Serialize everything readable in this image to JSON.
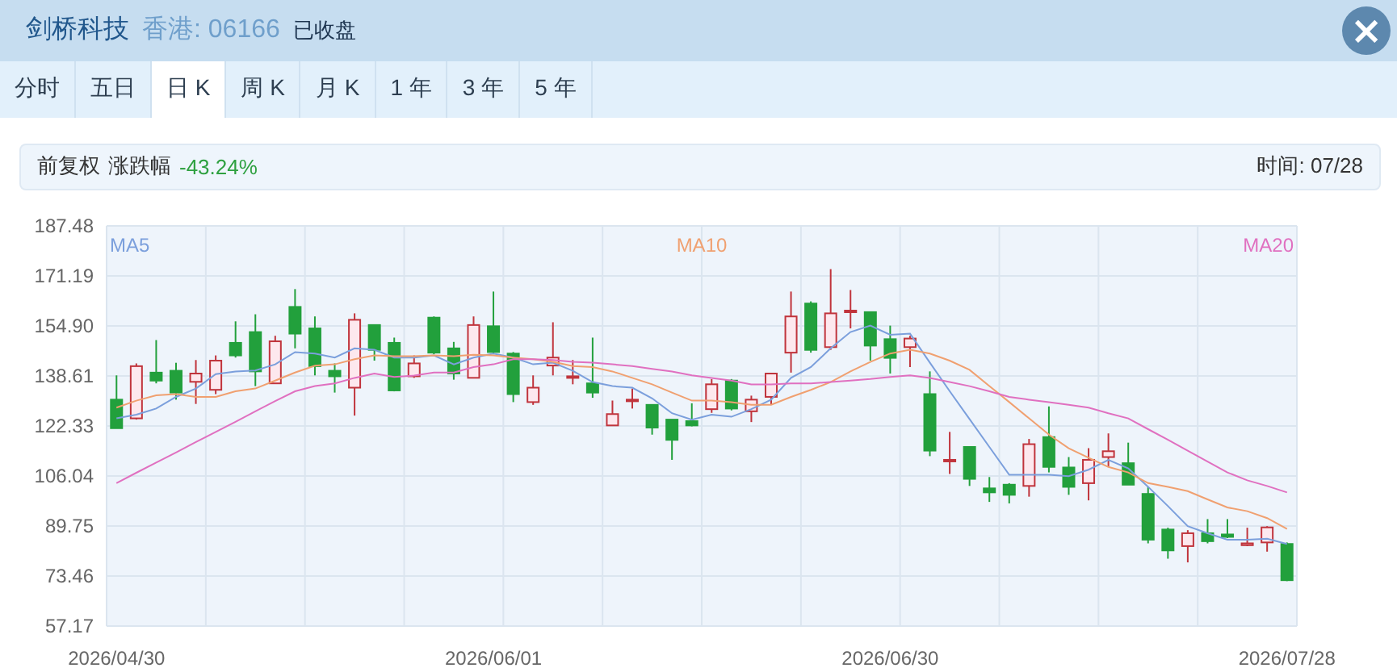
{
  "header": {
    "title": "剑桥科技",
    "market": "香港: 06166",
    "status": "已收盘",
    "close": "×"
  },
  "tabs": [
    {
      "label": "分时",
      "selected": false
    },
    {
      "label": "五日",
      "selected": false
    },
    {
      "label": "日 K",
      "selected": true
    },
    {
      "label": "周 K",
      "selected": false
    },
    {
      "label": "月 K",
      "selected": false
    },
    {
      "label": "1 年",
      "selected": false
    },
    {
      "label": "3 年",
      "selected": false
    },
    {
      "label": "5 年",
      "selected": false
    }
  ],
  "info": {
    "adjust": "前复权",
    "change_label": "涨跌幅",
    "change": "-43.24%",
    "time": "时间: 07/28"
  },
  "chart": {
    "chart_data": {
      "type": "candlestick",
      "grid": true,
      "ylim": [
        57.17,
        187.48
      ],
      "categories": [
        "2026/04/30",
        null,
        null,
        null,
        null,
        null,
        null,
        null,
        null,
        null,
        null,
        null,
        null,
        null,
        null,
        null,
        null,
        null,
        null,
        "2026/06/01",
        null,
        null,
        null,
        null,
        null,
        null,
        null,
        null,
        null,
        null,
        null,
        null,
        null,
        null,
        null,
        null,
        null,
        null,
        null,
        "2026/06/30",
        null,
        null,
        null,
        null,
        null,
        null,
        null,
        null,
        null,
        null,
        null,
        null,
        null,
        null,
        null,
        null,
        null,
        null,
        null,
        "2026/07/28"
      ],
      "yticks": [
        {
          "value": 57.17,
          "label": "57.17"
        },
        {
          "value": 73.46,
          "label": "73.46"
        },
        {
          "value": 89.75,
          "label": "89.75"
        },
        {
          "value": 106.04,
          "label": "106.04"
        },
        {
          "value": 122.33,
          "label": "122.33"
        },
        {
          "value": 138.61,
          "label": "138.61"
        },
        {
          "value": 154.9,
          "label": "154.90"
        },
        {
          "value": 171.19,
          "label": "171.19"
        },
        {
          "value": 187.48,
          "label": "187.48"
        }
      ],
      "series": [
        {
          "name": "MA5",
          "type": "line",
          "color": "#7b9fdc",
          "values": [
            124.8,
            126.0,
            128.0,
            131.8,
            134.5,
            139.2,
            140.1,
            140.4,
            142.4,
            146.4,
            145.9,
            144.6,
            147.6,
            147.1,
            144.6,
            144.6,
            145.3,
            142.4,
            144.6,
            145.9,
            144.6,
            142.4,
            142.9,
            140.3,
            136.6,
            135.3,
            134.8,
            131.3,
            126.5,
            124.4,
            126.0,
            125.3,
            127.8,
            130.9,
            138.0,
            141.5,
            147.6,
            152.9,
            155.0,
            152.0,
            152.4,
            142.9,
            133.7,
            124.6,
            115.5,
            106.4,
            106.4,
            106.4,
            106.0,
            108.1,
            111.3,
            108.5,
            102.5,
            96.2,
            89.7,
            87.4,
            85.3,
            85.3,
            85.6,
            83.9
          ]
        },
        {
          "name": "MA10",
          "type": "line",
          "color": "#f0a070",
          "values": [
            128.3,
            130.6,
            132.3,
            132.7,
            131.8,
            131.8,
            133.6,
            134.5,
            137.1,
            139.7,
            142.0,
            142.4,
            144.1,
            145.3,
            145.0,
            145.0,
            145.3,
            145.0,
            145.5,
            145.3,
            144.6,
            144.1,
            143.2,
            141.8,
            141.5,
            140.1,
            138.0,
            135.9,
            133.2,
            130.6,
            130.6,
            130.1,
            129.2,
            129.2,
            131.8,
            134.1,
            136.6,
            140.1,
            143.2,
            145.9,
            147.1,
            145.9,
            143.6,
            140.6,
            135.3,
            130.1,
            124.8,
            119.5,
            115.1,
            112.0,
            109.0,
            107.2,
            103.7,
            102.5,
            101.1,
            98.4,
            95.8,
            94.6,
            92.3,
            88.8
          ]
        },
        {
          "name": "MA20",
          "type": "line",
          "color": "#e070c0",
          "values": [
            103.7,
            107.1,
            110.4,
            113.7,
            117.1,
            120.4,
            123.7,
            127.1,
            130.4,
            133.6,
            135.3,
            136.2,
            138.0,
            139.4,
            138.3,
            138.7,
            139.7,
            139.7,
            141.5,
            142.4,
            144.1,
            144.1,
            143.8,
            143.2,
            142.9,
            142.4,
            141.8,
            140.9,
            140.1,
            138.8,
            138.0,
            137.1,
            135.9,
            135.9,
            136.2,
            136.2,
            136.6,
            137.1,
            137.6,
            138.3,
            138.8,
            138.0,
            136.6,
            135.3,
            133.6,
            131.8,
            130.9,
            130.1,
            129.2,
            128.3,
            126.5,
            124.8,
            121.3,
            117.8,
            114.3,
            110.7,
            107.2,
            104.6,
            102.8,
            100.7
          ]
        }
      ],
      "ohlc": [
        [
          130.9,
          138.8,
          121.6,
          121.6
        ],
        [
          124.8,
          142.7,
          124.4,
          141.8
        ],
        [
          139.7,
          150.3,
          136.2,
          137.1
        ],
        [
          140.3,
          142.9,
          130.9,
          133.2
        ],
        [
          136.7,
          143.8,
          129.5,
          139.4
        ],
        [
          134.1,
          145.3,
          132.7,
          143.6
        ],
        [
          149.4,
          156.4,
          144.6,
          145.3
        ],
        [
          152.9,
          158.7,
          135.3,
          140.1
        ],
        [
          136.2,
          151.7,
          136.2,
          149.9
        ],
        [
          161.1,
          166.9,
          147.6,
          152.4
        ],
        [
          154.1,
          158.0,
          138.8,
          141.8
        ],
        [
          140.3,
          142.7,
          133.2,
          138.5
        ],
        [
          134.8,
          159.0,
          125.7,
          156.9
        ],
        [
          155.2,
          155.2,
          143.6,
          147.1
        ],
        [
          149.4,
          151.1,
          133.6,
          133.9
        ],
        [
          138.5,
          145.3,
          138.0,
          142.7
        ],
        [
          157.6,
          158.0,
          145.7,
          146.2
        ],
        [
          147.6,
          149.7,
          137.4,
          139.4
        ],
        [
          138.0,
          158.0,
          138.0,
          155.2
        ],
        [
          154.8,
          166.1,
          145.9,
          146.4
        ],
        [
          145.9,
          146.4,
          130.1,
          132.7
        ],
        [
          130.1,
          138.8,
          129.2,
          134.8
        ],
        [
          142.0,
          156.1,
          138.8,
          144.6
        ],
        [
          138.0,
          143.8,
          135.9,
          138.5
        ],
        [
          136.2,
          151.1,
          131.5,
          133.2
        ],
        [
          122.5,
          130.6,
          122.5,
          126.2
        ],
        [
          130.6,
          134.5,
          128.0,
          130.9
        ],
        [
          129.2,
          129.2,
          119.5,
          121.8
        ],
        [
          124.4,
          124.4,
          111.3,
          117.8
        ],
        [
          123.9,
          129.7,
          122.2,
          122.5
        ],
        [
          127.8,
          137.6,
          126.6,
          135.9
        ],
        [
          137.1,
          137.6,
          127.4,
          128.0
        ],
        [
          127.1,
          132.2,
          123.6,
          130.9
        ],
        [
          131.8,
          139.4,
          129.2,
          139.4
        ],
        [
          146.2,
          166.1,
          139.7,
          158.0
        ],
        [
          162.2,
          162.9,
          146.2,
          147.1
        ],
        [
          148.0,
          173.4,
          147.1,
          159.0
        ],
        [
          159.6,
          166.6,
          154.1,
          159.9
        ],
        [
          159.4,
          159.4,
          143.6,
          148.5
        ],
        [
          150.6,
          155.0,
          139.4,
          144.5
        ],
        [
          148.0,
          151.7,
          141.5,
          150.8
        ],
        [
          132.7,
          140.1,
          112.5,
          114.3
        ],
        [
          110.8,
          120.4,
          106.7,
          111.3
        ],
        [
          115.5,
          115.5,
          102.8,
          105.1
        ],
        [
          102.0,
          105.7,
          97.6,
          100.7
        ],
        [
          103.2,
          103.7,
          97.1,
          99.9
        ],
        [
          102.8,
          118.1,
          99.3,
          116.4
        ],
        [
          118.7,
          128.7,
          107.2,
          109.0
        ],
        [
          108.8,
          112.2,
          99.9,
          102.5
        ],
        [
          103.7,
          115.1,
          98.1,
          111.3
        ],
        [
          112.2,
          119.9,
          109.0,
          114.1
        ],
        [
          110.2,
          116.9,
          103.2,
          103.2
        ],
        [
          100.2,
          102.5,
          84.1,
          85.3
        ],
        [
          88.6,
          89.2,
          79.1,
          81.8
        ],
        [
          83.2,
          88.4,
          77.9,
          87.4
        ],
        [
          87.4,
          92.0,
          84.1,
          84.8
        ],
        [
          87.0,
          92.0,
          85.8,
          86.2
        ],
        [
          83.5,
          89.2,
          83.2,
          84.1
        ],
        [
          84.4,
          89.7,
          81.4,
          89.3
        ],
        [
          83.9,
          84.4,
          71.8,
          72.1
        ]
      ]
    }
  }
}
